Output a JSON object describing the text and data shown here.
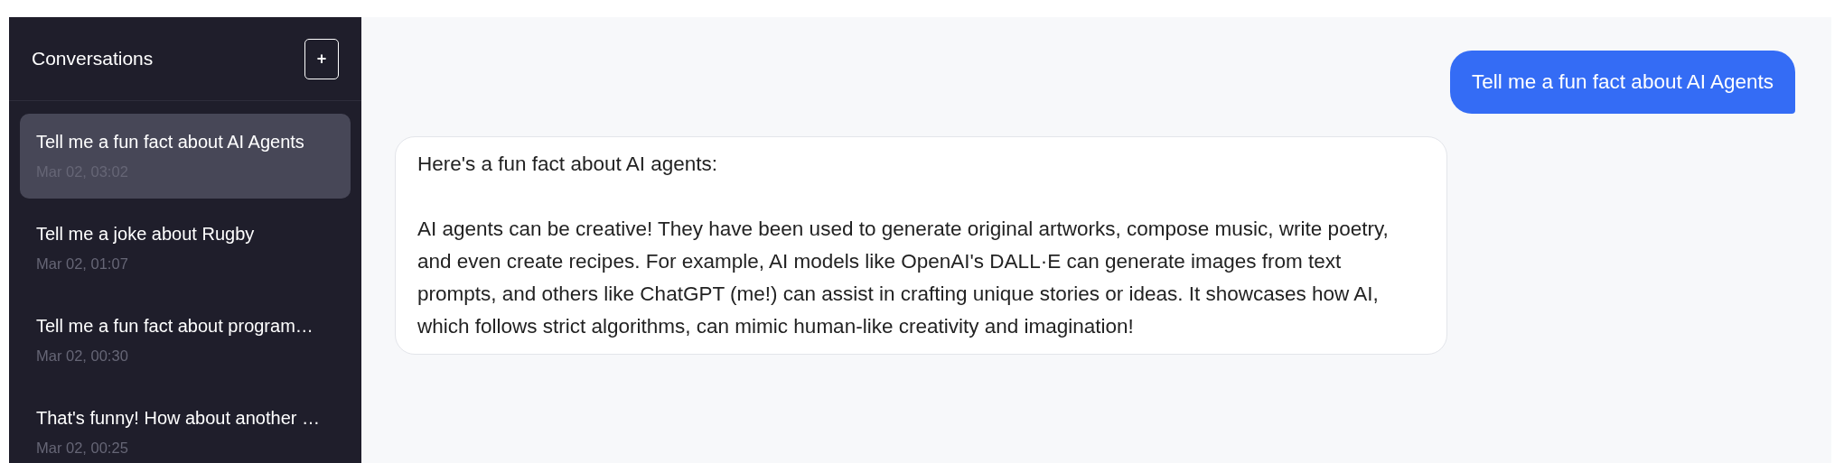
{
  "sidebar": {
    "title": "Conversations",
    "new_button": "+",
    "items": [
      {
        "title": "Tell me a fun fact about AI Agents",
        "date": "Mar 02, 03:02",
        "selected": true
      },
      {
        "title": "Tell me a joke about Rugby",
        "date": "Mar 02, 01:07",
        "selected": false
      },
      {
        "title": "Tell me a fun fact about program…",
        "date": "Mar 02, 00:30",
        "selected": false
      },
      {
        "title": "That's funny! How about another …",
        "date": "Mar 02, 00:25",
        "selected": false
      }
    ]
  },
  "messages": [
    {
      "kind": "user",
      "text": "Tell me a fun fact about AI Agents"
    },
    {
      "kind": "assistant",
      "text": "Here's a fun fact about AI agents:\n\nAI agents can be creative! They have been used to generate original artworks, compose music, write poetry, and even create recipes. For example, AI models like OpenAI's DALL·E can generate images from text prompts, and others like ChatGPT (me!) can assist in crafting unique stories or ideas. It showcases how AI, which follows strict algorithms, can mimic human-like creativity and imagination!"
    }
  ]
}
